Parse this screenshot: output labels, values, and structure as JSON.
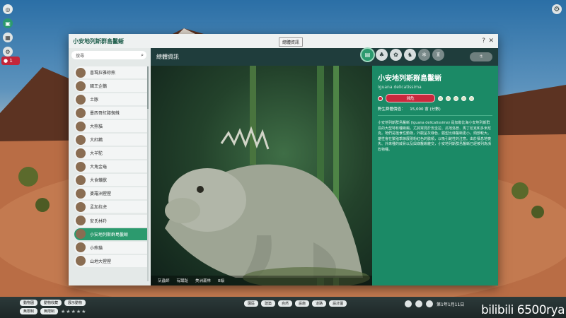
{
  "window": {
    "title": "小安地列斯群島鬣蜥",
    "help": "?",
    "close": "✕",
    "tooltip": "總體資訊"
  },
  "left": {
    "search_placeholder": "搜尋",
    "items": [
      {
        "label": "喜瑪拉雅棕熊",
        "selected": false
      },
      {
        "label": "國王企鵝",
        "selected": false
      },
      {
        "label": "土豚",
        "selected": false
      },
      {
        "label": "墨西哥紅膝蜘蛛",
        "selected": false
      },
      {
        "label": "大熊貓",
        "selected": false
      },
      {
        "label": "大紅鸛",
        "selected": false
      },
      {
        "label": "大羊駝",
        "selected": false
      },
      {
        "label": "大角金龜",
        "selected": false
      },
      {
        "label": "大食蟻獸",
        "selected": false
      },
      {
        "label": "婆羅洲猩猩",
        "selected": false
      },
      {
        "label": "孟加拉虎",
        "selected": false
      },
      {
        "label": "安氏林羚",
        "selected": false
      },
      {
        "label": "小安地列斯群島鬣蜥",
        "selected": true
      },
      {
        "label": "小熊貓",
        "selected": false
      },
      {
        "label": "山地大猩猩",
        "selected": false
      }
    ]
  },
  "content": {
    "section_title": "總體資訊",
    "tabs": [
      "document-icon",
      "habitat-icon",
      "food-icon",
      "social-icon",
      "paw-icon",
      "trophy-icon"
    ]
  },
  "photo": {
    "captions": [
      "灰蟲師",
      "有蹼趾",
      "美洲叢林",
      "B級"
    ]
  },
  "info": {
    "name": "小安地列斯群島鬣蜥",
    "latin": "Iguana delicatissima",
    "status": "瀕危",
    "value_label": "野生群體價值：",
    "value": "15,000 會 (分數)",
    "description": "小安地列斯群島鬣蜥 (Iguana delicatissima) 是加勒比海小安地列斯群島的大型特有種蜥蜴。尤其常見於安圭拉、瓜地洛普、馬丁尼克和多米尼克。牠們是植食性動物，外觀呈灰綠色，體型比綠鬣蜥更小，頭部較大。雄性會在繁殖季節展現粉紅色的臉頰，以吸引雌性的注意。由於棲息地喪失、外來種的威脅以及與綠鬣蜥雜交，小安地列斯群島鬣蜥已經被列為瀕危物種。"
  },
  "bottom": {
    "row1": [
      "動物園",
      "動物收藏",
      "展示動物"
    ],
    "row2": [
      "無限制",
      "無限制"
    ],
    "mid": [
      "園區",
      "建築",
      "自然",
      "設施",
      "道路",
      "設計圖"
    ],
    "date": "第1年1月11日"
  },
  "watermark": "bilibili 6500rya"
}
